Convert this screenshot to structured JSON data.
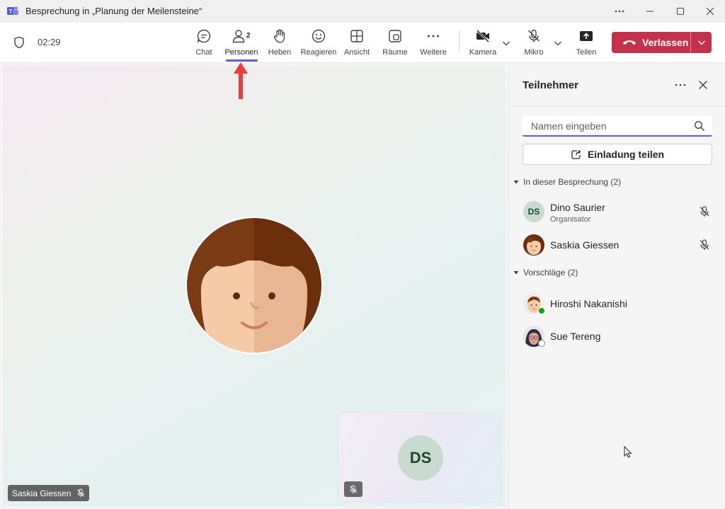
{
  "window": {
    "title": "Besprechung in „Planung der Meilensteine“"
  },
  "toolbar": {
    "timer": "02:29",
    "items": [
      {
        "label": "Chat",
        "icon": "chat-icon"
      },
      {
        "label": "Personen",
        "icon": "people-icon",
        "count": "2",
        "active": true
      },
      {
        "label": "Heben",
        "icon": "raise-hand-icon"
      },
      {
        "label": "Reagieren",
        "icon": "react-icon"
      },
      {
        "label": "Ansicht",
        "icon": "view-icon"
      },
      {
        "label": "Räume",
        "icon": "rooms-icon"
      },
      {
        "label": "Weitere",
        "icon": "more-icon"
      },
      {
        "label": "Kamera",
        "icon": "camera-off-icon"
      },
      {
        "label": "Mikro",
        "icon": "mic-off-icon"
      },
      {
        "label": "Teilen",
        "icon": "share-icon"
      }
    ],
    "leave_label": "Verlassen",
    "colors": {
      "leave": "#c4314b",
      "accent": "#5b5fc7"
    }
  },
  "stage": {
    "speaker_name": "Saskia Giessen",
    "self_initials": "DS"
  },
  "panel": {
    "title": "Teilnehmer",
    "search_placeholder": "Namen eingeben",
    "invite_label": "Einladung teilen",
    "in_meeting_header": "In dieser Besprechung (2)",
    "suggestions_header": "Vorschläge (2)",
    "in_meeting": [
      {
        "name": "Dino Saurier",
        "role": "Organisator",
        "initials": "DS",
        "muted": true
      },
      {
        "name": "Saskia Giessen",
        "role": "",
        "muted": true
      }
    ],
    "suggestions": [
      {
        "name": "Hiroshi Nakanishi",
        "status": "available"
      },
      {
        "name": "Sue Tereng",
        "status": "offline"
      }
    ]
  }
}
